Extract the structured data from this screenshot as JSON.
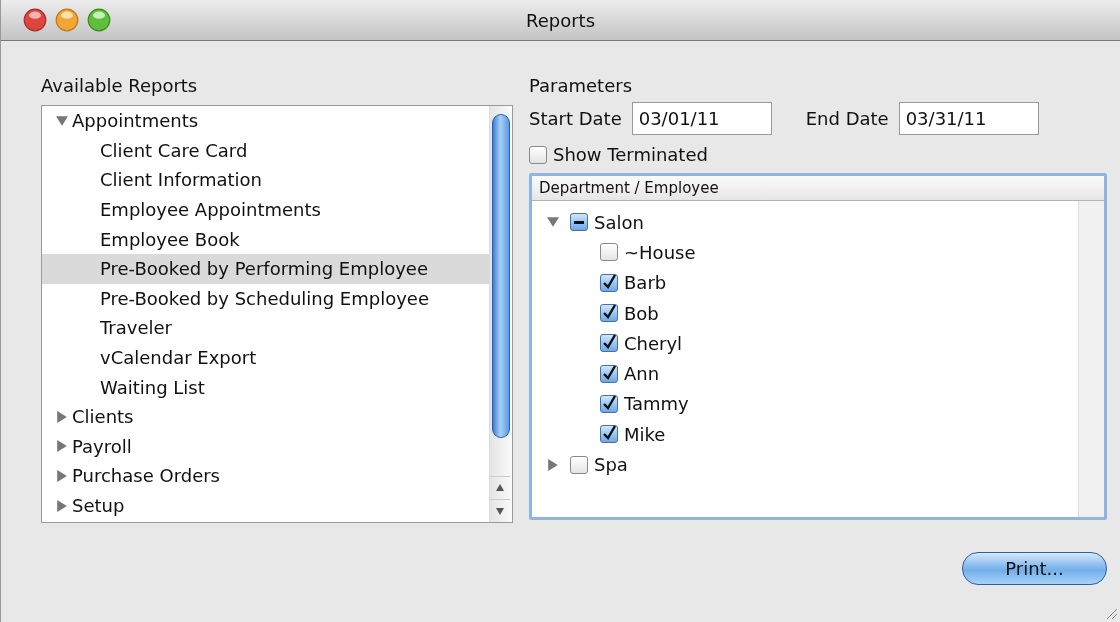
{
  "window": {
    "title": "Reports"
  },
  "available_reports": {
    "label": "Available Reports",
    "items": [
      {
        "label": "Appointments",
        "expanded": true,
        "selected": false,
        "children": [
          {
            "label": "Client Care Card",
            "selected": false
          },
          {
            "label": "Client Information",
            "selected": false
          },
          {
            "label": "Employee Appointments",
            "selected": false
          },
          {
            "label": "Employee Book",
            "selected": false
          },
          {
            "label": "Pre-Booked by Performing Employee",
            "selected": true
          },
          {
            "label": "Pre-Booked by Scheduling Employee",
            "selected": false
          },
          {
            "label": "Traveler",
            "selected": false
          },
          {
            "label": "vCalendar Export",
            "selected": false
          },
          {
            "label": "Waiting List",
            "selected": false
          }
        ]
      },
      {
        "label": "Clients",
        "expanded": false,
        "selected": false
      },
      {
        "label": "Payroll",
        "expanded": false,
        "selected": false
      },
      {
        "label": "Purchase Orders",
        "expanded": false,
        "selected": false
      },
      {
        "label": "Setup",
        "expanded": false,
        "selected": false
      }
    ]
  },
  "parameters": {
    "label": "Parameters",
    "start_date": {
      "label": "Start Date",
      "value": "03/01/11"
    },
    "end_date": {
      "label": "End Date",
      "value": "03/31/11"
    },
    "show_terminated": {
      "label": "Show Terminated",
      "checked": false
    },
    "employees": {
      "column": "Department / Employee",
      "items": [
        {
          "label": "Salon",
          "expanded": true,
          "checked": true,
          "mixed": true,
          "children": [
            {
              "label": "~House",
              "checked": false
            },
            {
              "label": "Barb",
              "checked": true
            },
            {
              "label": "Bob",
              "checked": true
            },
            {
              "label": "Cheryl",
              "checked": true
            },
            {
              "label": "Ann",
              "checked": true
            },
            {
              "label": "Tammy",
              "checked": true
            },
            {
              "label": "Mike",
              "checked": true
            }
          ]
        },
        {
          "label": "Spa",
          "expanded": false,
          "checked": false
        }
      ]
    }
  },
  "buttons": [
    {
      "label": "Print..."
    }
  ]
}
